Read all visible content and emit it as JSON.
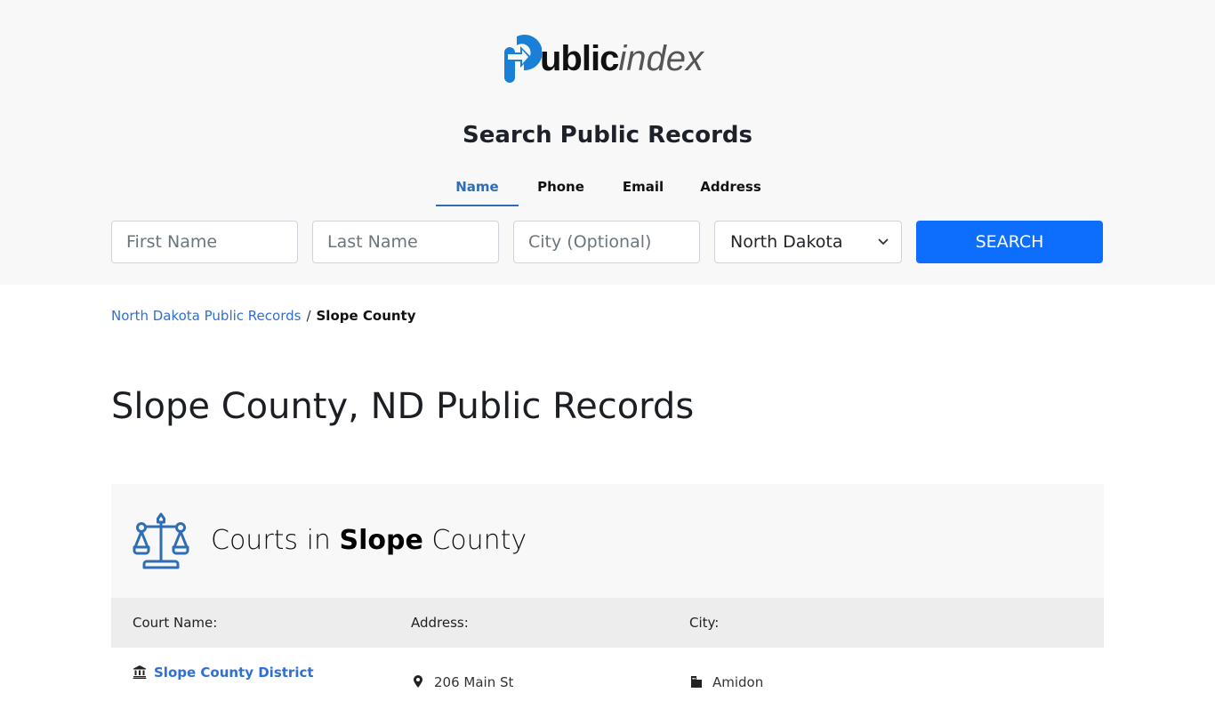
{
  "brand": {
    "logo_bold": "ublic",
    "logo_light": "index",
    "accent_color": "#1a7fd6"
  },
  "search": {
    "title": "Search Public Records",
    "tabs": [
      {
        "label": "Name",
        "active": true
      },
      {
        "label": "Phone",
        "active": false
      },
      {
        "label": "Email",
        "active": false
      },
      {
        "label": "Address",
        "active": false
      }
    ],
    "first_name_placeholder": "First Name",
    "last_name_placeholder": "Last Name",
    "city_placeholder": "City (Optional)",
    "state_selected": "North Dakota",
    "button_label": "SEARCH",
    "button_color": "#0d6efd"
  },
  "breadcrumb": {
    "parent": "North Dakota Public Records",
    "separator": "/",
    "current": "Slope County"
  },
  "page_title": "Slope County, ND Public Records",
  "courts": {
    "title_prefix": "Courts in ",
    "title_county": "Slope",
    "title_suffix": " County",
    "columns": [
      "Court Name:",
      "Address:",
      "City:"
    ],
    "rows": [
      {
        "name": "Slope County District",
        "address": "206 Main St",
        "city": "Amidon"
      }
    ]
  }
}
